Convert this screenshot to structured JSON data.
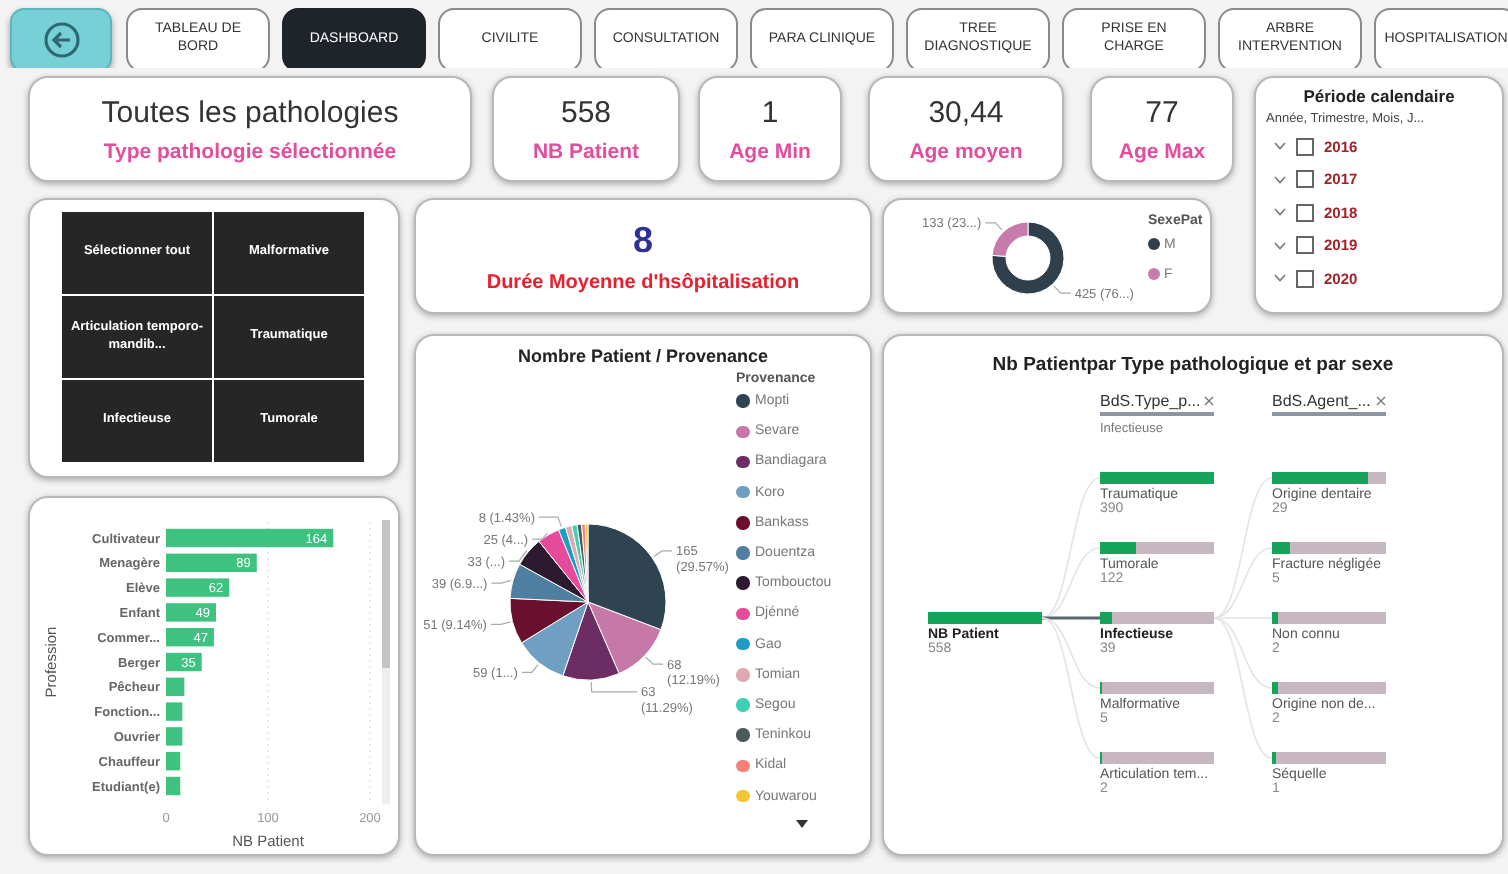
{
  "tabs": [
    {
      "label": "TABLEAU DE BORD",
      "selected": false
    },
    {
      "label": "DASHBOARD",
      "selected": true
    },
    {
      "label": "CIVILITE",
      "selected": false
    },
    {
      "label": "CONSULTATION",
      "selected": false
    },
    {
      "label": "PARA CLINIQUE",
      "selected": false
    },
    {
      "label": "TREE DIAGNOSTIQUE",
      "selected": false
    },
    {
      "label": "PRISE EN CHARGE",
      "selected": false
    },
    {
      "label": "ARBRE INTERVENTION",
      "selected": false
    },
    {
      "label": "HOSPITALISATION",
      "selected": false
    }
  ],
  "headline": {
    "value": "Toutes les pathologies",
    "caption": "Type pathologie sélectionnée"
  },
  "metrics": [
    {
      "value": "558",
      "caption": "NB Patient"
    },
    {
      "value": "1",
      "caption": "Age Min"
    },
    {
      "value": "30,44",
      "caption": "Age moyen"
    },
    {
      "value": "77",
      "caption": "Age Max"
    }
  ],
  "date_filter": {
    "title": "Période calendaire",
    "hierarchy": "Année, Trimestre, Mois, J...",
    "years": [
      {
        "label": "2016",
        "checked": false
      },
      {
        "label": "2017",
        "checked": false
      },
      {
        "label": "2018",
        "checked": false
      },
      {
        "label": "2019",
        "checked": false
      },
      {
        "label": "2020",
        "checked": false
      }
    ]
  },
  "pathology_tiles": [
    "Sélectionner tout",
    "Malformative",
    "Articulation temporo-mandib...",
    "Traumatique",
    "Infectieuse",
    "Tumorale"
  ],
  "avg_stay": {
    "value": "8",
    "caption": "Durée Moyenne d'hsôpitalisation"
  },
  "sex_chart": {
    "legend_title": "SexePat",
    "chart_data": {
      "type": "donut",
      "categories": [
        "M",
        "F"
      ],
      "values": [
        425,
        133
      ],
      "colors": [
        "#2f3f4c",
        "#c77bab"
      ],
      "value_labels": [
        "425 (76...)",
        "133 (23...)"
      ]
    }
  },
  "provenance_chart": {
    "legend_title": "Provenance",
    "chart_data": {
      "type": "pie",
      "title": "Nombre Patient / Provenance",
      "categories": [
        "Mopti",
        "Sevare",
        "Bandiagara",
        "Koro",
        "Bankass",
        "Douentza",
        "Tombouctou",
        "Djénné",
        "Gao",
        "Tomian",
        "Segou",
        "Teninkou",
        "Kidal",
        "Youwarou"
      ],
      "values": [
        165,
        68,
        63,
        59,
        51,
        39,
        33,
        25,
        8,
        7,
        6,
        5,
        4,
        3
      ],
      "colors": [
        "#2e4453",
        "#c678a8",
        "#6b2d63",
        "#6f9fc2",
        "#6a0f2e",
        "#4f7fa0",
        "#2c1a2e",
        "#e64a9a",
        "#1f9cc1",
        "#dcaab0",
        "#3fcfb5",
        "#4b5a5a",
        "#f4807a",
        "#f3c632"
      ],
      "value_labels": [
        "165 (29.57%)",
        "68 (12.19%)",
        "63 (11.29%)",
        "59 (1...)",
        "51 (9.14%)",
        "39 (6.9...)",
        "33 (...)",
        "25 (4...)",
        "8 (1.43%)",
        null,
        null,
        null,
        null,
        null
      ]
    }
  },
  "profession_chart": {
    "chart_data": {
      "type": "bar",
      "orientation": "horizontal",
      "xlabel": "NB Patient",
      "ylabel": "Profession",
      "categories": [
        "Cultivateur",
        "Menagère",
        "Elève",
        "Enfant",
        "Commer...",
        "Berger",
        "Pêcheur",
        "Fonction...",
        "Ouvrier",
        "Chauffeur",
        "Etudiant(e)"
      ],
      "values": [
        164,
        89,
        62,
        49,
        47,
        35,
        18,
        16,
        16,
        14,
        14
      ],
      "xlim": [
        0,
        200
      ],
      "xticks": [
        0,
        100,
        200
      ],
      "value_labels": [
        "164",
        "89",
        "62",
        "49",
        "47",
        "35",
        null,
        null,
        null,
        null,
        null
      ]
    }
  },
  "tree": {
    "title": "Nb Patientpar Type pathologique et par sexe",
    "levels": [
      {
        "label": "BdS.Type_p...",
        "subtitle": "Infectieuse"
      },
      {
        "label": "BdS.Agent_..."
      }
    ],
    "root": {
      "label": "NB Patient",
      "value": "558",
      "level": 1,
      "children": [
        {
          "label": "Traumatique",
          "value": "390",
          "level": 1,
          "selected": false
        },
        {
          "label": "Tumorale",
          "value": "122",
          "level": 0.31,
          "selected": false
        },
        {
          "label": "Infectieuse",
          "value": "39",
          "level": 0.1,
          "selected": true,
          "children": [
            {
              "label": "Origine dentaire",
              "value": "29",
              "level": 0.85
            },
            {
              "label": "Fracture négligée",
              "value": "5",
              "level": 0.15
            },
            {
              "label": "Non connu",
              "value": "2",
              "level": 0.06
            },
            {
              "label": "Origine non de...",
              "value": "2",
              "level": 0.06
            },
            {
              "label": "Séquelle",
              "value": "1",
              "level": 0.04
            }
          ]
        },
        {
          "label": "Malformative",
          "value": "5",
          "level": 0.015,
          "selected": false
        },
        {
          "label": "Articulation tem...",
          "value": "2",
          "level": 0.01,
          "selected": false
        }
      ]
    }
  }
}
